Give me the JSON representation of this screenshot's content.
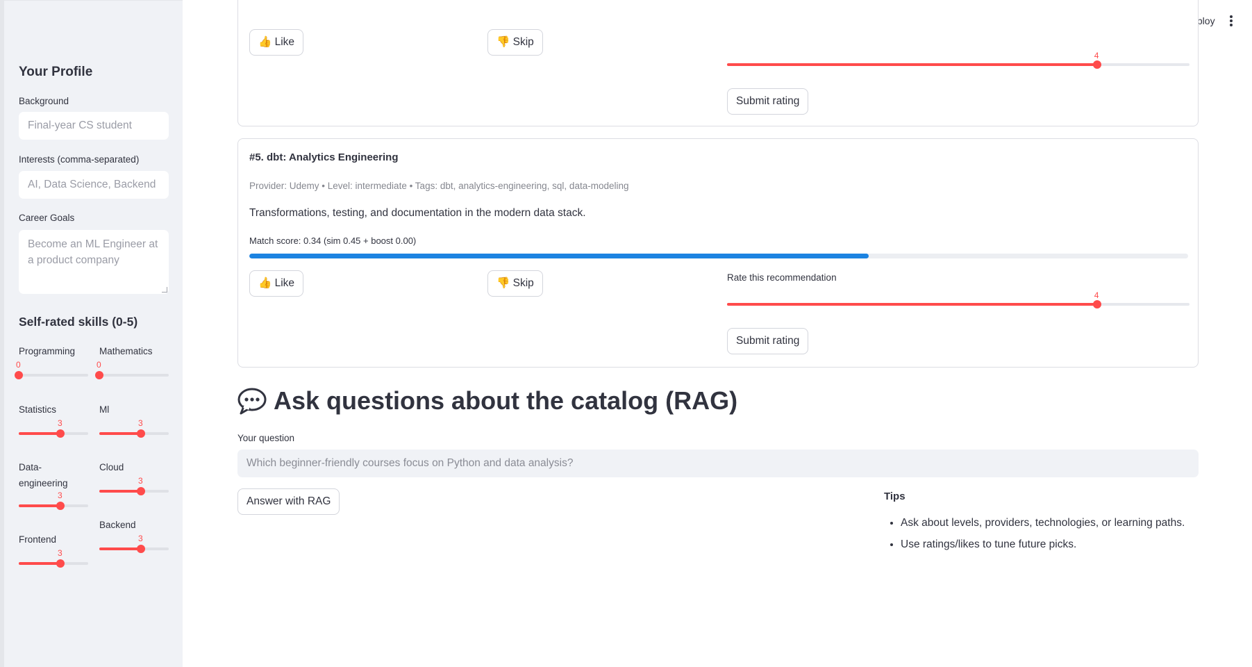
{
  "topbar": {
    "deploy_label": "Deploy",
    "menu_icon": "kebab-menu-icon"
  },
  "sidebar": {
    "title": "Your Profile",
    "background": {
      "label": "Background",
      "placeholder": "Final-year CS student"
    },
    "interests": {
      "label": "Interests (comma-separated)",
      "placeholder": "AI, Data Science, Backend"
    },
    "career_goals": {
      "label": "Career Goals",
      "placeholder": "Become an ML Engineer at a product company"
    },
    "skills_title": "Self-rated skills (0-5)",
    "skills": [
      {
        "label": "Programming",
        "value": 0,
        "max": 5
      },
      {
        "label": "Mathematics",
        "value": 0,
        "max": 5
      },
      {
        "label": "Statistics",
        "value": 3,
        "max": 5
      },
      {
        "label": "Ml",
        "value": 3,
        "max": 5
      },
      {
        "label": "Data-engineering",
        "value": 3,
        "max": 5
      },
      {
        "label": "Cloud",
        "value": 3,
        "max": 5
      },
      {
        "label": "Frontend",
        "value": 3,
        "max": 5
      },
      {
        "label": "Backend",
        "value": 3,
        "max": 5
      }
    ],
    "accent_color": "#ff4b4b"
  },
  "cards": [
    {
      "like_label": "👍 Like",
      "skip_label": "👎 Skip",
      "rating": {
        "value": 4,
        "max": 5
      },
      "submit_label": "Submit rating"
    },
    {
      "title": "#5. dbt: Analytics Engineering",
      "meta": "Provider: Udemy • Level: intermediate • Tags: dbt, analytics-engineering, sql, data-modeling",
      "description": "Transformations, testing, and documentation in the modern data stack.",
      "score_text": "Match score: 0.34 (sim 0.45 + boost 0.00)",
      "progress_fraction": 0.66,
      "like_label": "👍 Like",
      "skip_label": "👎 Skip",
      "rate_label": "Rate this recommendation",
      "rating": {
        "value": 4,
        "max": 5
      },
      "submit_label": "Submit rating"
    }
  ],
  "rag": {
    "heading": "Ask questions about the catalog (RAG)",
    "heading_icon": "speech-bubble-icon",
    "question_label": "Your question",
    "question_placeholder": "Which beginner-friendly courses focus on Python and data analysis?",
    "answer_button": "Answer with RAG",
    "tips_title": "Tips",
    "tips": [
      "Ask about levels, providers, technologies, or learning paths.",
      "Use ratings/likes to tune future picks."
    ]
  },
  "colors": {
    "progress": "#1c83e1",
    "slider": "#ff4b4b",
    "sidebar_bg": "#f0f2f6"
  }
}
